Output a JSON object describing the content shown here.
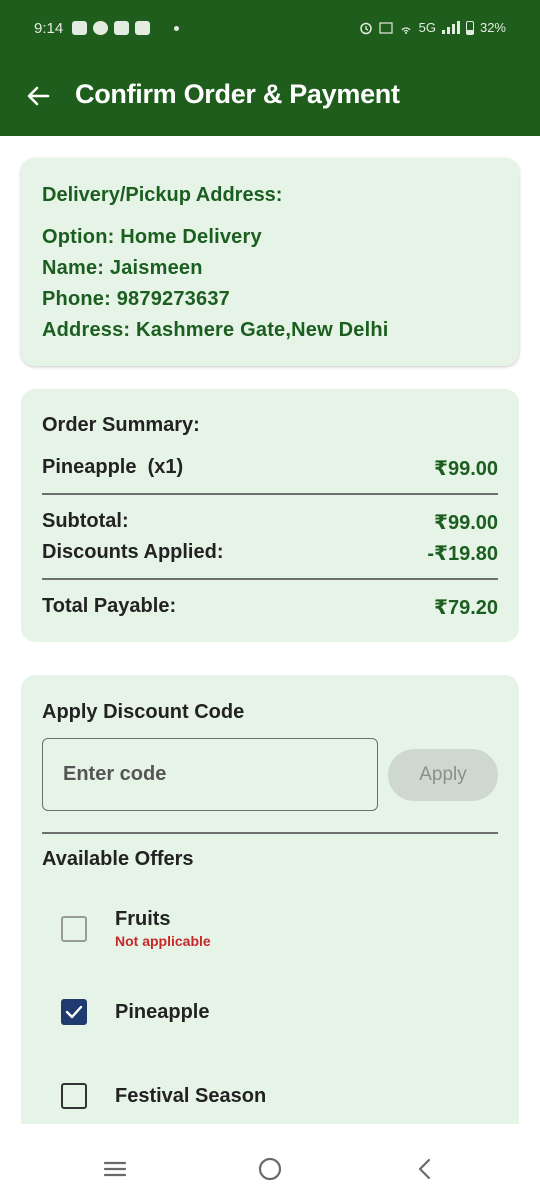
{
  "status_bar": {
    "time": "9:14",
    "network": "5G",
    "battery": "32%",
    "icons": [
      "youtube-icon",
      "messenger-icon",
      "linkedin-icon",
      "gmail-icon",
      "alarm-icon",
      "volte-icon",
      "hotspot-icon",
      "signal-icon",
      "battery-icon"
    ]
  },
  "app_bar": {
    "title": "Confirm Order & Payment",
    "back_icon": "arrow-left-icon"
  },
  "address": {
    "heading": "Delivery/Pickup Address:",
    "option": "Option: Home Delivery",
    "name": "Name: Jaismeen",
    "phone": "Phone: 9879273637",
    "address": "Address: Kashmere Gate,New Delhi"
  },
  "summary": {
    "heading": "Order Summary:",
    "items": [
      {
        "name": "Pineapple  (x1)",
        "price": "₹99.00"
      }
    ],
    "subtotal_label": "Subtotal:",
    "subtotal_value": "₹99.00",
    "discount_label": "Discounts Applied:",
    "discount_value": "-₹19.80",
    "total_label": "Total Payable:",
    "total_value": "₹79.20"
  },
  "discount": {
    "heading": "Apply Discount Code",
    "input_placeholder": "Enter code",
    "input_value": "",
    "apply_label": "Apply",
    "offers_heading": "Available Offers",
    "offers": [
      {
        "label": "Fruits",
        "sub": "Not applicable",
        "checked": false,
        "enabled": false
      },
      {
        "label": "Pineapple",
        "sub": "",
        "checked": true,
        "enabled": true
      },
      {
        "label": "Festival Season",
        "sub": "",
        "checked": false,
        "enabled": true
      }
    ]
  },
  "colors": {
    "primary": "#1f5d1c",
    "card_bg": "#e6f4e7",
    "green_text": "#1b5e20",
    "error": "#c62828",
    "checkbox_checked": "#1e3a6e"
  },
  "nav_bar": {
    "icons": [
      "recent-apps-icon",
      "home-icon",
      "back-icon"
    ]
  }
}
